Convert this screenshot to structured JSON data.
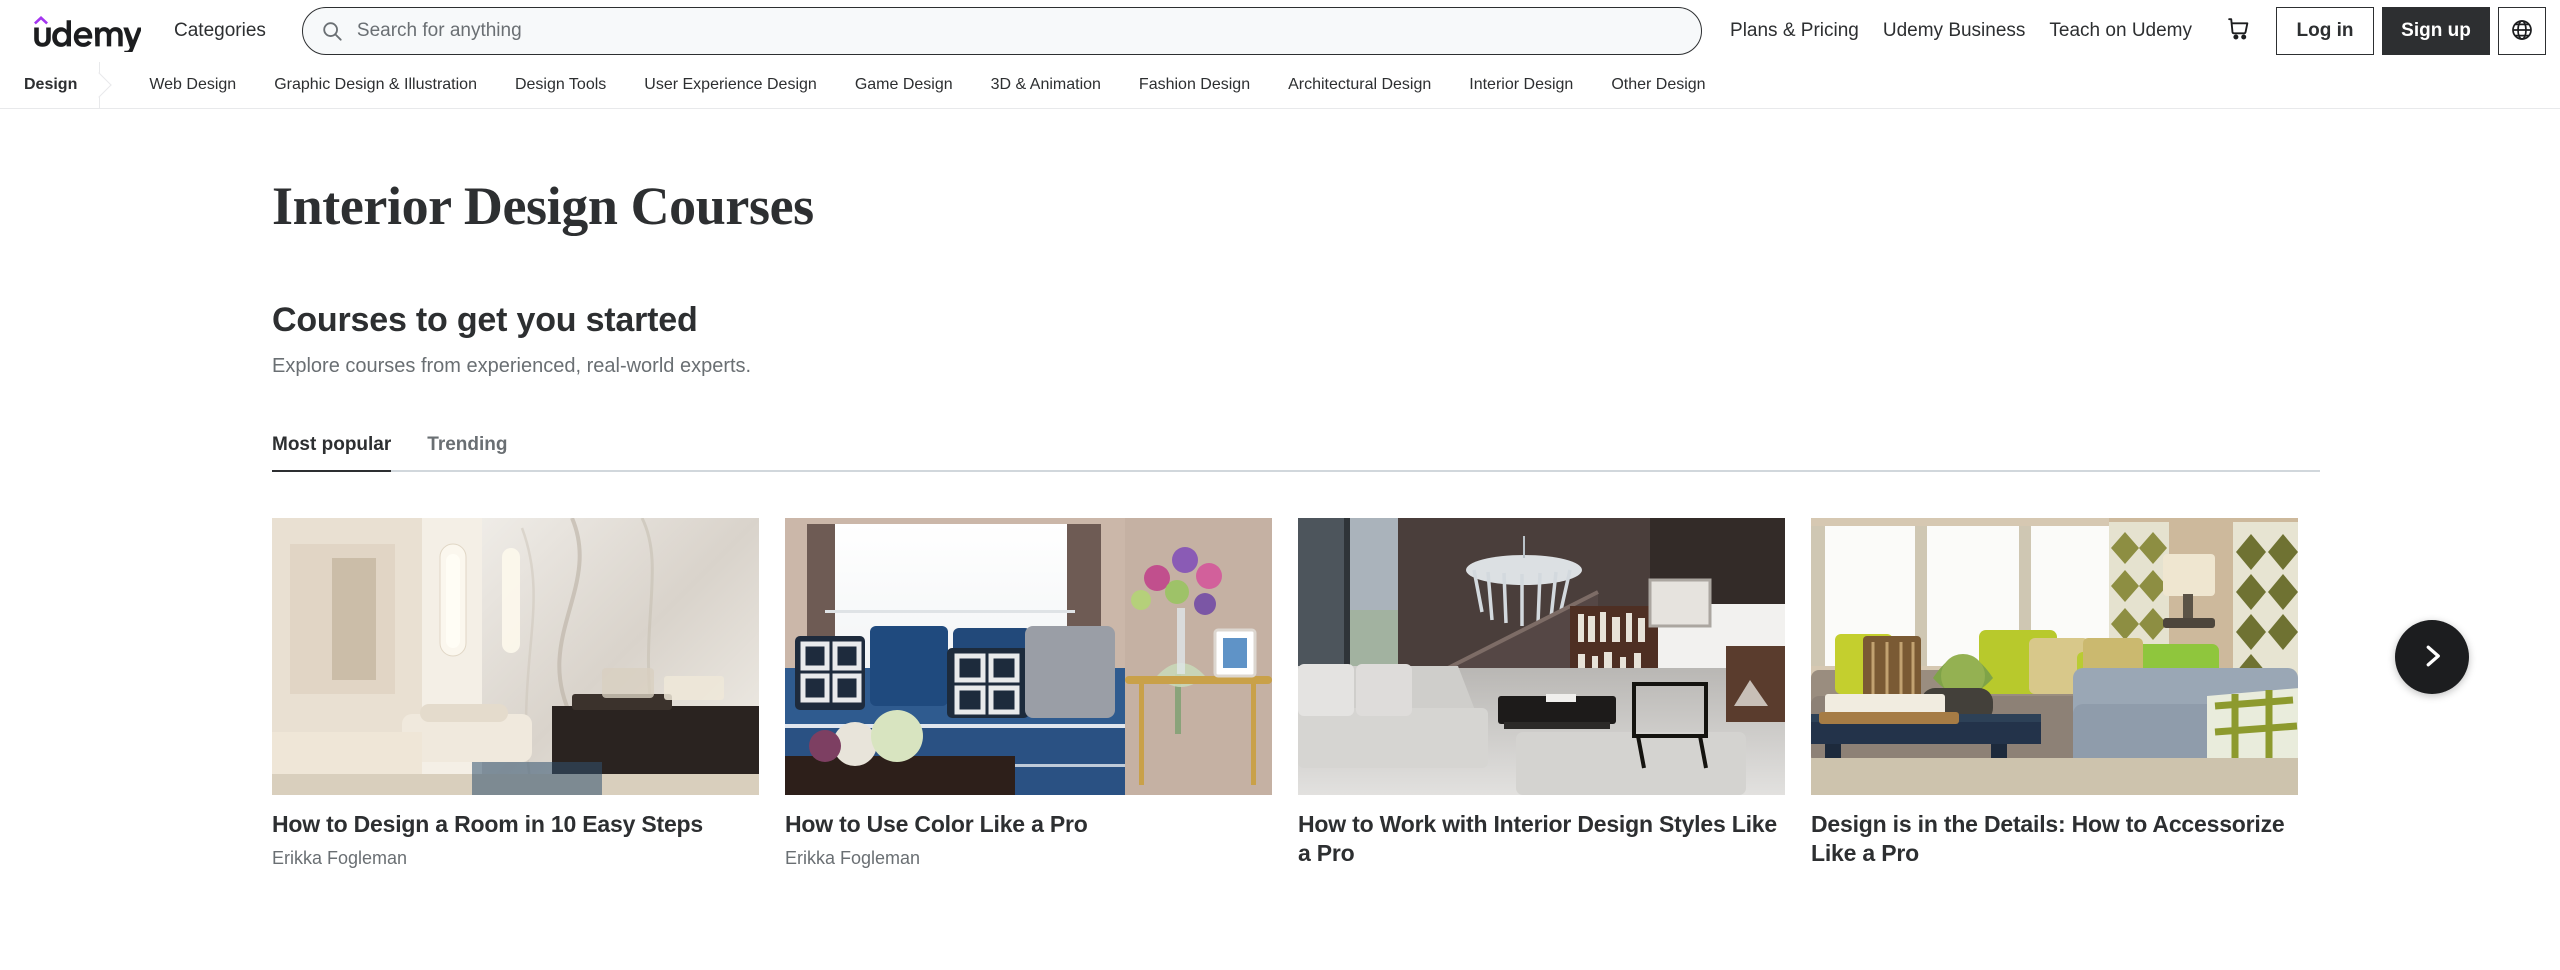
{
  "header": {
    "logo_text": "udemy",
    "categories_label": "Categories",
    "search": {
      "placeholder": "Search for anything",
      "value": "",
      "icon": "search-icon"
    },
    "nav_links": [
      {
        "label": "Plans & Pricing"
      },
      {
        "label": "Udemy Business"
      },
      {
        "label": "Teach on Udemy"
      }
    ],
    "cart_icon": "shopping-cart-icon",
    "login_label": "Log in",
    "signup_label": "Sign up",
    "language_icon": "globe-icon",
    "accent_color": "#a435f0",
    "dark_color": "#2d2f31"
  },
  "category_bar": {
    "current": "Design",
    "items": [
      {
        "label": "Web Design"
      },
      {
        "label": "Graphic Design & Illustration"
      },
      {
        "label": "Design Tools"
      },
      {
        "label": "User Experience Design"
      },
      {
        "label": "Game Design"
      },
      {
        "label": "3D & Animation"
      },
      {
        "label": "Fashion Design"
      },
      {
        "label": "Architectural Design"
      },
      {
        "label": "Interior Design"
      },
      {
        "label": "Other Design"
      }
    ]
  },
  "page": {
    "title": "Interior Design Courses"
  },
  "section": {
    "heading": "Courses to get you started",
    "subheading": "Explore courses from experienced, real-world experts.",
    "tabs": [
      {
        "label": "Most popular",
        "active": true
      },
      {
        "label": "Trending",
        "active": false
      }
    ]
  },
  "carousel": {
    "next_icon": "chevron-right-icon",
    "cards": [
      {
        "title": "How to Design a Room in 10 Easy Steps",
        "author": "Erikka Fogleman",
        "thumb_name": "course-thumbnail-bright-marble-living-room"
      },
      {
        "title": "How to Use Color Like a Pro",
        "author": "Erikka Fogleman",
        "thumb_name": "course-thumbnail-blue-sofa-living-room"
      },
      {
        "title": "How to Work with Interior Design Styles Like a Pro",
        "author": "",
        "thumb_name": "course-thumbnail-modern-grey-loft-interior"
      },
      {
        "title": "Design is in the Details: How to Accessorize Like a Pro",
        "author": "",
        "thumb_name": "course-thumbnail-green-pillows-living-room"
      }
    ]
  }
}
